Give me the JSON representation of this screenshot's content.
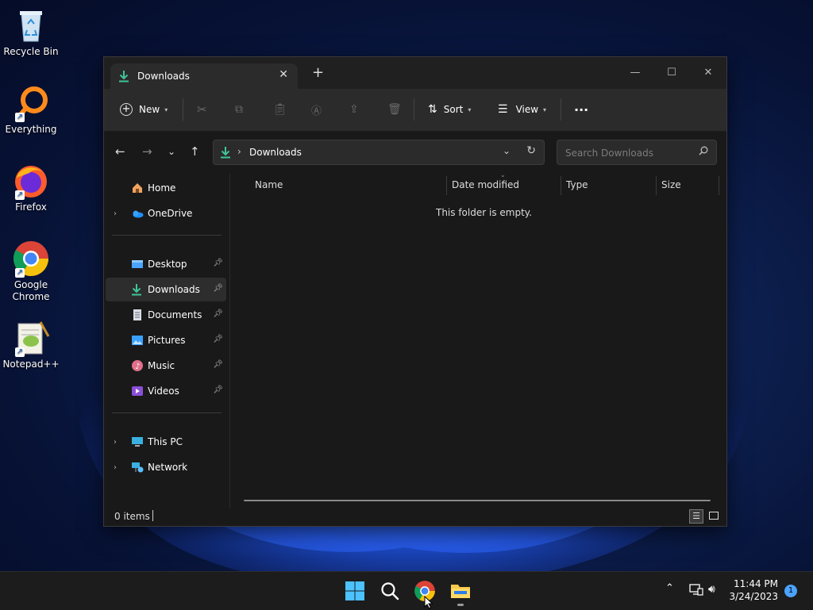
{
  "desktop": {
    "icons": [
      {
        "label": "Recycle Bin"
      },
      {
        "label": "Everything"
      },
      {
        "label": "Firefox"
      },
      {
        "label": "Google Chrome"
      },
      {
        "label": "Notepad++"
      }
    ]
  },
  "window": {
    "tab_title": "Downloads",
    "newtab_glyph": "+",
    "toolbar": {
      "new_label": "New",
      "sort_label": "Sort",
      "view_label": "View",
      "more_glyph": "···"
    },
    "address": {
      "path": "Downloads"
    },
    "search": {
      "placeholder": "Search Downloads"
    },
    "nav": {
      "home": "Home",
      "onedrive": "OneDrive",
      "quick": [
        {
          "label": "Desktop"
        },
        {
          "label": "Downloads"
        },
        {
          "label": "Documents"
        },
        {
          "label": "Pictures"
        },
        {
          "label": "Music"
        },
        {
          "label": "Videos"
        }
      ],
      "thispc": "This PC",
      "network": "Network"
    },
    "columns": {
      "name": "Name",
      "date": "Date modified",
      "type": "Type",
      "size": "Size"
    },
    "empty_message": "This folder is empty.",
    "status": {
      "items": "0 items"
    }
  },
  "taskbar": {
    "time": "11:44 PM",
    "date": "3/24/2023",
    "notification_count": "1"
  },
  "colors": {
    "accent": "#4aa3ff",
    "download_green": "#3fc59a",
    "window_bg": "#191919",
    "toolbar_bg": "#2b2b2b"
  }
}
